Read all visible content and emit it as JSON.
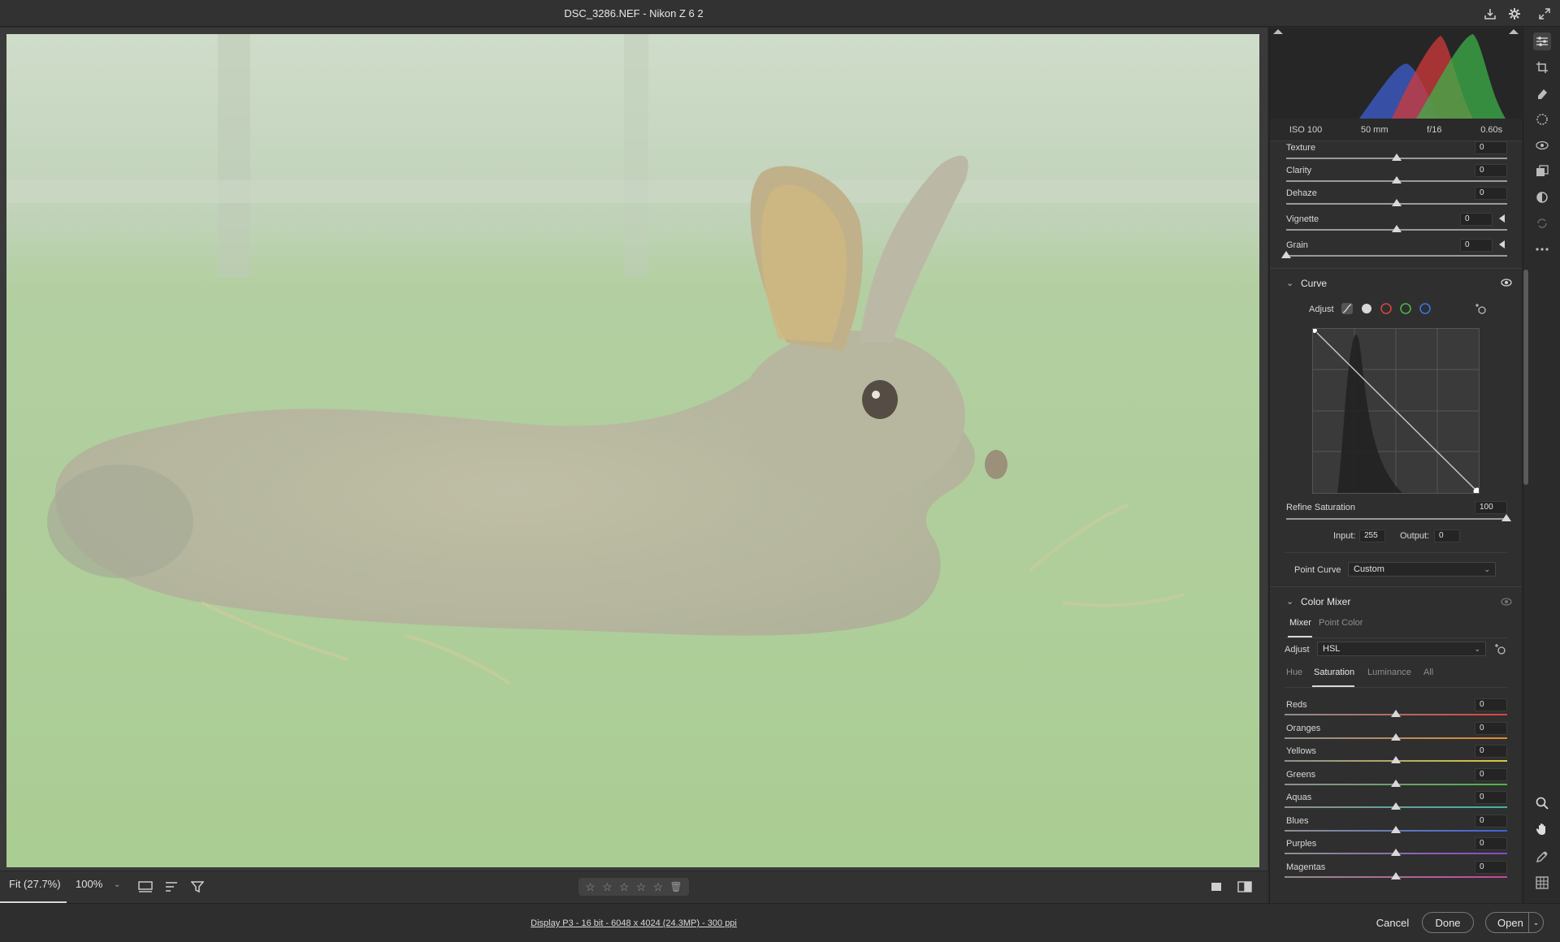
{
  "window": {
    "title": "DSC_3286.NEF  -  Nikon Z 6 2"
  },
  "header_icons": [
    "save-icon",
    "gear-icon",
    "fullscreen-icon"
  ],
  "exif": {
    "iso": "ISO 100",
    "focal": "50 mm",
    "aperture": "f/16",
    "shutter": "0.60s"
  },
  "sliders_top": [
    {
      "label": "Texture",
      "value": "0",
      "level": 0.5
    },
    {
      "label": "Clarity",
      "value": "0",
      "level": 0.5
    },
    {
      "label": "Dehaze",
      "value": "0",
      "level": 0.5
    },
    {
      "label": "Vignette",
      "value": "0",
      "level": 0.5
    },
    {
      "label": "Grain",
      "value": "0",
      "level": 0
    }
  ],
  "curve": {
    "title": "Curve",
    "adjust_label": "Adjust",
    "refine_label": "Refine Saturation",
    "refine_value": "100",
    "input_label": "Input:",
    "input_value": "255",
    "output_label": "Output:",
    "output_value": "0",
    "point_curve_label": "Point Curve",
    "point_curve_value": "Custom"
  },
  "color_mixer": {
    "title": "Color Mixer",
    "tabs": [
      "Mixer",
      "Point Color"
    ],
    "adjust_label": "Adjust",
    "adjust_value": "HSL",
    "subtabs": [
      "Hue",
      "Saturation",
      "Luminance",
      "All"
    ],
    "rows": [
      {
        "label": "Reds",
        "value": "0",
        "color": "#d9463b"
      },
      {
        "label": "Oranges",
        "value": "0",
        "color": "#e18a2f"
      },
      {
        "label": "Yellows",
        "value": "0",
        "color": "#d8c93a"
      },
      {
        "label": "Greens",
        "value": "0",
        "color": "#4fb34a"
      },
      {
        "label": "Aquas",
        "value": "0",
        "color": "#3fb3a6"
      },
      {
        "label": "Blues",
        "value": "0",
        "color": "#3d63d6"
      },
      {
        "label": "Purples",
        "value": "0",
        "color": "#8a47c9"
      },
      {
        "label": "Magentas",
        "value": "0",
        "color": "#c8449a"
      }
    ]
  },
  "bottom": {
    "fit": "Fit (27.7%)",
    "zoom": "100%",
    "status": "Display P3 - 16 bit - 6048 x 4024 (24.3MP) - 300 ppi"
  },
  "buttons": {
    "cancel": "Cancel",
    "done": "Done",
    "open": "Open"
  }
}
